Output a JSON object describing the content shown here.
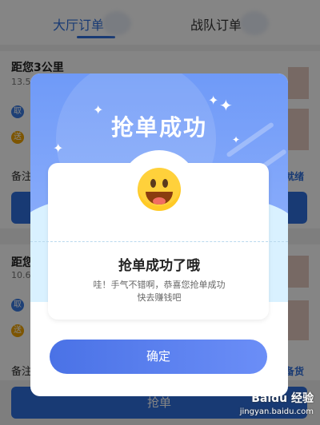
{
  "tabs": {
    "active": "大厅订单",
    "inactive": "战队订单"
  },
  "orders": [
    {
      "distance": "距您3公里",
      "sub": "13.5",
      "take": "取",
      "send": "送",
      "note": "备注",
      "status": "就绪"
    },
    {
      "distance": "距您",
      "sub": "10.6",
      "take": "取",
      "send": "送",
      "note": "备注",
      "status": "备货"
    }
  ],
  "modal": {
    "title": "抢单成功",
    "headline": "抢单成功了哦",
    "desc_line1": "哇！手气不错啊，恭喜您抢单成功",
    "desc_line2": "快去赚钱吧",
    "confirm": "确定"
  },
  "bottom_button": "抢单",
  "watermark": {
    "brand": "Baidu 经验",
    "url": "jingyan.baidu.com"
  },
  "colors": {
    "accent": "#2f6fde",
    "modal_top": "#6f9af8",
    "confirm_start": "#4a72e6",
    "confirm_end": "#6b8ef7"
  }
}
